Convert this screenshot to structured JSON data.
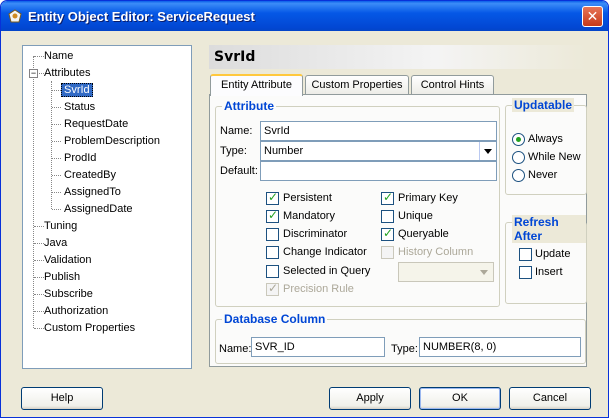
{
  "window": {
    "title": "Entity Object Editor: ServiceRequest",
    "close_label": "✕"
  },
  "tree": {
    "items": [
      {
        "label": "Name"
      },
      {
        "label": "Attributes"
      },
      {
        "label": "SvrId"
      },
      {
        "label": "Status"
      },
      {
        "label": "RequestDate"
      },
      {
        "label": "ProblemDescription"
      },
      {
        "label": "ProdId"
      },
      {
        "label": "CreatedBy"
      },
      {
        "label": "AssignedTo"
      },
      {
        "label": "AssignedDate"
      },
      {
        "label": "Tuning"
      },
      {
        "label": "Java"
      },
      {
        "label": "Validation"
      },
      {
        "label": "Publish"
      },
      {
        "label": "Subscribe"
      },
      {
        "label": "Authorization"
      },
      {
        "label": "Custom Properties"
      }
    ],
    "expander": "−"
  },
  "page_title": "SvrId",
  "tabs": [
    {
      "label": "Entity Attribute"
    },
    {
      "label": "Custom Properties"
    },
    {
      "label": "Control Hints"
    }
  ],
  "attribute": {
    "group_label": "Attribute",
    "name_label": "Name:",
    "name_value": "SvrId",
    "type_label": "Type:",
    "type_value": "Number",
    "default_label": "Default:",
    "default_value": ""
  },
  "checkboxes": {
    "persistent": "Persistent",
    "mandatory": "Mandatory",
    "discriminator": "Discriminator",
    "change_indicator": "Change Indicator",
    "selected_in_query": "Selected in Query",
    "precision_rule": "Precision Rule",
    "primary_key": "Primary Key",
    "unique": "Unique",
    "queryable": "Queryable",
    "history_column": "History Column"
  },
  "database_column": {
    "group_label": "Database Column",
    "name_label": "Name:",
    "name_value": "SVR_ID",
    "type_label": "Type:",
    "type_value": "NUMBER(8, 0)"
  },
  "updatable": {
    "group_label": "Updatable",
    "always": "Always",
    "while_new": "While New",
    "never": "Never"
  },
  "refresh_after": {
    "group_label": "Refresh After",
    "update": "Update",
    "insert": "Insert"
  },
  "buttons": {
    "help": "Help",
    "apply": "Apply",
    "ok": "OK",
    "cancel": "Cancel"
  },
  "colors": {
    "title_bar": "#0A5FE9",
    "selection": "#316AC5",
    "group_label": "#0046D5"
  }
}
